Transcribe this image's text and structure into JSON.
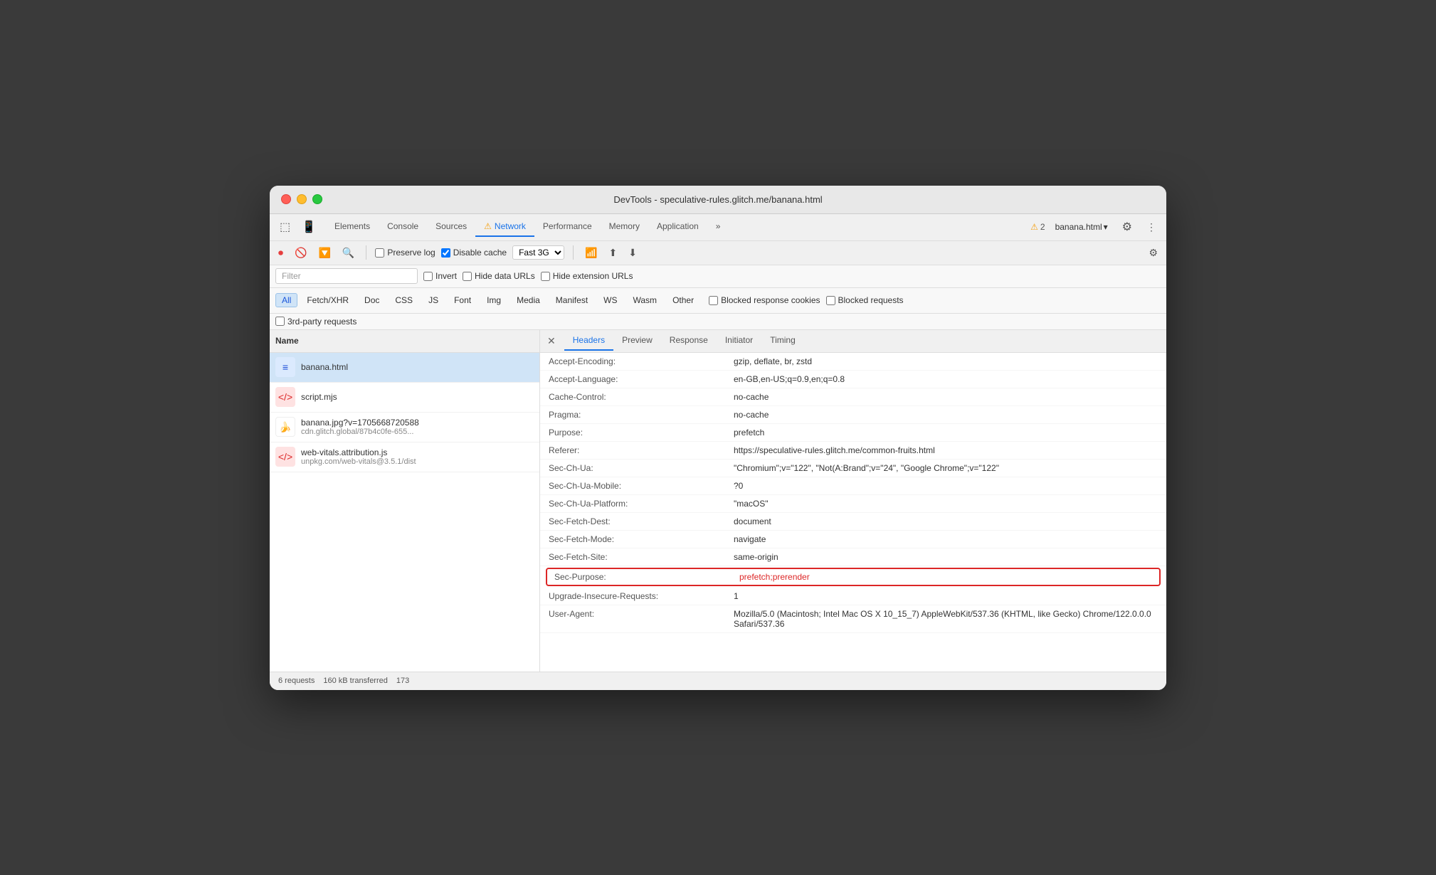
{
  "window": {
    "title": "DevTools - speculative-rules.glitch.me/banana.html"
  },
  "top_tabs": {
    "items": [
      {
        "label": "Elements",
        "active": false
      },
      {
        "label": "Console",
        "active": false
      },
      {
        "label": "Sources",
        "active": false
      },
      {
        "label": "Network",
        "active": true,
        "warn": true
      },
      {
        "label": "Performance",
        "active": false
      },
      {
        "label": "Memory",
        "active": false
      },
      {
        "label": "Application",
        "active": false
      },
      {
        "label": "»",
        "active": false
      }
    ],
    "warn_count": "2",
    "filename": "banana.html"
  },
  "toolbar": {
    "preserve_log_label": "Preserve log",
    "disable_cache_label": "Disable cache",
    "throttle_value": "Fast 3G"
  },
  "filter_bar": {
    "filter_placeholder": "Filter",
    "invert_label": "Invert",
    "hide_data_urls_label": "Hide data URLs",
    "hide_ext_urls_label": "Hide extension URLs"
  },
  "type_filter": {
    "buttons": [
      {
        "label": "All",
        "active": true
      },
      {
        "label": "Fetch/XHR",
        "active": false
      },
      {
        "label": "Doc",
        "active": false
      },
      {
        "label": "CSS",
        "active": false
      },
      {
        "label": "JS",
        "active": false
      },
      {
        "label": "Font",
        "active": false
      },
      {
        "label": "Img",
        "active": false
      },
      {
        "label": "Media",
        "active": false
      },
      {
        "label": "Manifest",
        "active": false
      },
      {
        "label": "WS",
        "active": false
      },
      {
        "label": "Wasm",
        "active": false
      },
      {
        "label": "Other",
        "active": false
      }
    ],
    "blocked_response_cookies_label": "Blocked response cookies",
    "blocked_requests_label": "Blocked requests",
    "third_party_label": "3rd-party requests"
  },
  "file_list": {
    "header": "Name",
    "items": [
      {
        "name": "banana.html",
        "url": "",
        "icon_type": "html",
        "icon_char": "≡",
        "selected": true
      },
      {
        "name": "script.mjs",
        "url": "",
        "icon_type": "js",
        "icon_char": "</>",
        "selected": false
      },
      {
        "name": "banana.jpg?v=1705668720588",
        "url": "cdn.glitch.global/87b4c0fe-655...",
        "icon_type": "img",
        "icon_char": "🍌",
        "selected": false
      },
      {
        "name": "web-vitals.attribution.js",
        "url": "unpkg.com/web-vitals@3.5.1/dist",
        "icon_type": "js",
        "icon_char": "</>",
        "selected": false
      }
    ]
  },
  "details_panel": {
    "tabs": [
      {
        "label": "Headers",
        "active": true
      },
      {
        "label": "Preview",
        "active": false
      },
      {
        "label": "Response",
        "active": false
      },
      {
        "label": "Initiator",
        "active": false
      },
      {
        "label": "Timing",
        "active": false
      }
    ],
    "headers": [
      {
        "name": "Accept-Encoding:",
        "value": "gzip, deflate, br, zstd",
        "highlighted": false
      },
      {
        "name": "Accept-Language:",
        "value": "en-GB,en-US;q=0.9,en;q=0.8",
        "highlighted": false
      },
      {
        "name": "Cache-Control:",
        "value": "no-cache",
        "highlighted": false
      },
      {
        "name": "Pragma:",
        "value": "no-cache",
        "highlighted": false
      },
      {
        "name": "Purpose:",
        "value": "prefetch",
        "highlighted": false
      },
      {
        "name": "Referer:",
        "value": "https://speculative-rules.glitch.me/common-fruits.html",
        "highlighted": false
      },
      {
        "name": "Sec-Ch-Ua:",
        "value": "\"Chromium\";v=\"122\", \"Not(A:Brand\";v=\"24\", \"Google Chrome\";v=\"122\"",
        "highlighted": false
      },
      {
        "name": "Sec-Ch-Ua-Mobile:",
        "value": "?0",
        "highlighted": false
      },
      {
        "name": "Sec-Ch-Ua-Platform:",
        "value": "\"macOS\"",
        "highlighted": false
      },
      {
        "name": "Sec-Fetch-Dest:",
        "value": "document",
        "highlighted": false
      },
      {
        "name": "Sec-Fetch-Mode:",
        "value": "navigate",
        "highlighted": false
      },
      {
        "name": "Sec-Fetch-Site:",
        "value": "same-origin",
        "highlighted": false
      },
      {
        "name": "Sec-Purpose:",
        "value": "prefetch;prerender",
        "highlighted": true
      },
      {
        "name": "Upgrade-Insecure-Requests:",
        "value": "1",
        "highlighted": false
      },
      {
        "name": "User-Agent:",
        "value": "Mozilla/5.0 (Macintosh; Intel Mac OS X 10_15_7) AppleWebKit/537.36 (KHTML, like Gecko) Chrome/122.0.0.0 Safari/537.36",
        "highlighted": false
      }
    ]
  },
  "status_bar": {
    "requests": "6 requests",
    "transferred": "160 kB transferred",
    "more": "173"
  }
}
